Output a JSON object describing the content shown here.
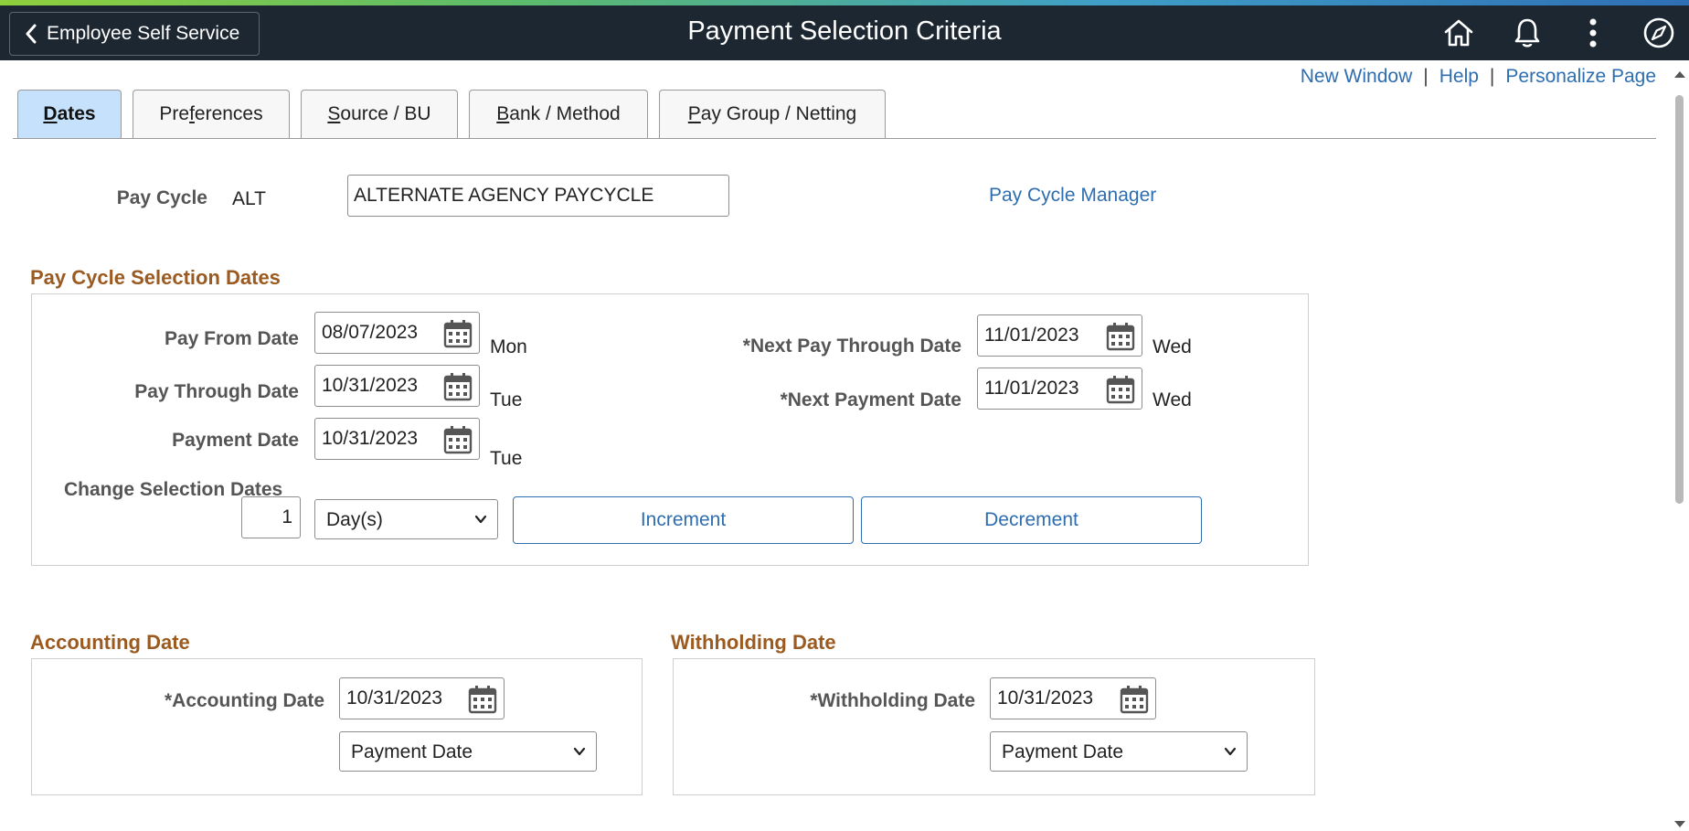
{
  "header": {
    "back_label": "Employee Self Service",
    "title": "Payment Selection Criteria",
    "icons": [
      "home-icon",
      "bell-icon",
      "more-vertical-icon",
      "compass-icon"
    ]
  },
  "toplinks": {
    "new_window": "New Window",
    "help": "Help",
    "personalize": "Personalize Page",
    "separator": "|"
  },
  "tabs": [
    {
      "label_pre": "",
      "label_u": "D",
      "label_post": "ates",
      "full": "Dates",
      "active": true
    },
    {
      "label_pre": "Pre",
      "label_u": "f",
      "label_post": "erences",
      "full": "Preferences",
      "active": false
    },
    {
      "label_pre": "",
      "label_u": "S",
      "label_post": "ource / BU",
      "full": "Source / BU",
      "active": false
    },
    {
      "label_pre": "",
      "label_u": "B",
      "label_post": "ank / Method",
      "full": "Bank / Method",
      "active": false
    },
    {
      "label_pre": "",
      "label_u": "P",
      "label_post": "ay Group / Netting",
      "full": "Pay Group / Netting",
      "active": false
    }
  ],
  "pay_cycle": {
    "label": "Pay Cycle",
    "code": "ALT",
    "description": "ALTERNATE AGENCY PAYCYCLE",
    "manager_link": "Pay Cycle Manager"
  },
  "selection_dates": {
    "title": "Pay Cycle Selection Dates",
    "pay_from": {
      "label": "Pay From Date",
      "value": "08/07/2023",
      "day": "Mon"
    },
    "pay_through": {
      "label": "Pay Through Date",
      "value": "10/31/2023",
      "day": "Tue"
    },
    "payment": {
      "label": "Payment Date",
      "value": "10/31/2023",
      "day": "Tue"
    },
    "next_pay_through": {
      "label": "*Next Pay Through Date",
      "value": "11/01/2023",
      "day": "Wed"
    },
    "next_payment": {
      "label": "*Next Payment Date",
      "value": "11/01/2023",
      "day": "Wed"
    },
    "change": {
      "label": "Change Selection Dates",
      "quantity": "1",
      "unit": "Day(s)",
      "increment": "Increment",
      "decrement": "Decrement"
    }
  },
  "accounting": {
    "title": "Accounting Date",
    "label": "*Accounting Date",
    "value": "10/31/2023",
    "basis": "Payment Date"
  },
  "withholding": {
    "title": "Withholding Date",
    "label": "*Withholding Date",
    "value": "10/31/2023",
    "basis": "Payment Date"
  },
  "colors": {
    "banner": "#1c2732",
    "link": "#2e6eb0",
    "section_title": "#9b5a1f",
    "active_tab": "#c6e1fb"
  }
}
